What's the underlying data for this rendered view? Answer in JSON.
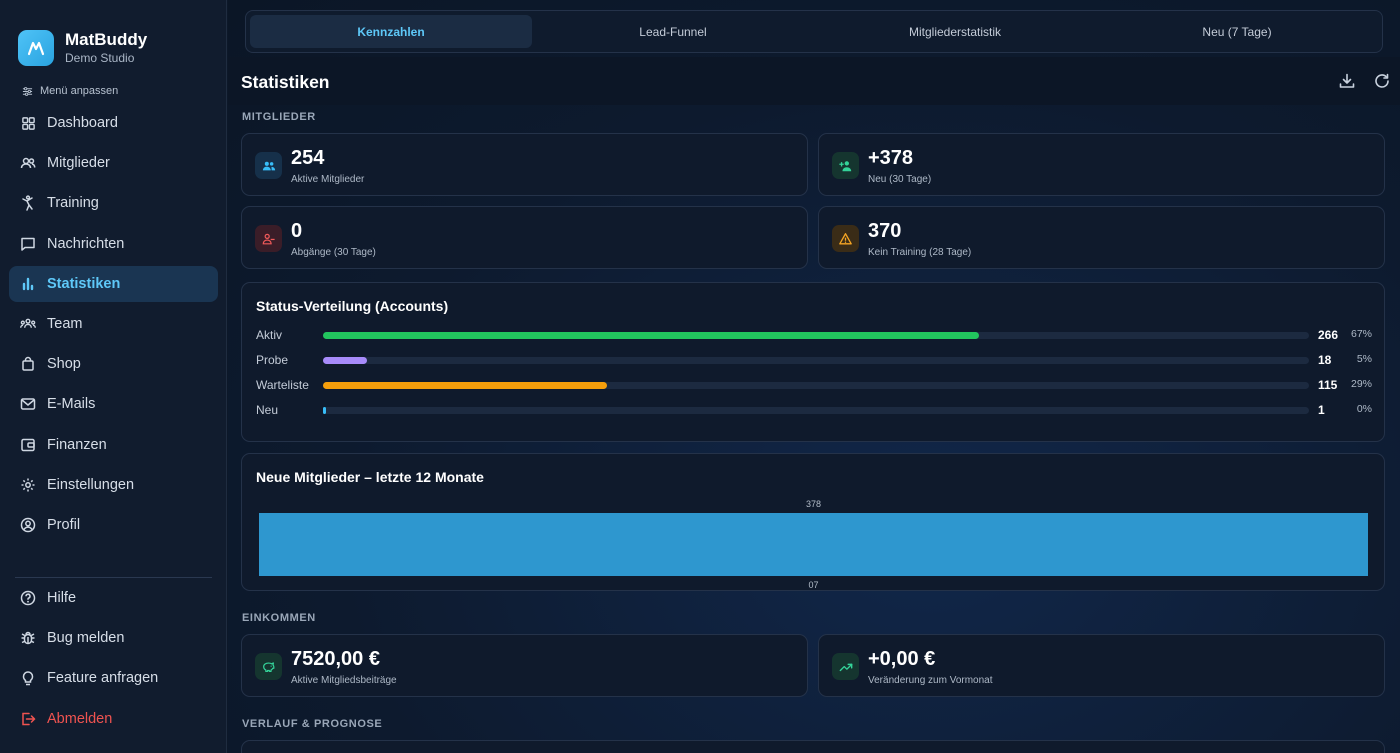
{
  "brand": {
    "name": "MatBuddy",
    "subtitle": "Demo Studio"
  },
  "menu_customize": "Menü anpassen",
  "nav": [
    {
      "label": "Dashboard",
      "icon": "grid-icon",
      "active": false
    },
    {
      "label": "Mitglieder",
      "icon": "users-icon",
      "active": false
    },
    {
      "label": "Training",
      "icon": "martial-arts-icon",
      "active": false
    },
    {
      "label": "Nachrichten",
      "icon": "chat-icon",
      "active": false
    },
    {
      "label": "Statistiken",
      "icon": "bar-chart-icon",
      "active": true
    },
    {
      "label": "Team",
      "icon": "team-icon",
      "active": false
    },
    {
      "label": "Shop",
      "icon": "shopping-bag-icon",
      "active": false
    },
    {
      "label": "E-Mails",
      "icon": "mail-icon",
      "active": false
    },
    {
      "label": "Finanzen",
      "icon": "wallet-icon",
      "active": false
    },
    {
      "label": "Einstellungen",
      "icon": "gear-icon",
      "active": false
    },
    {
      "label": "Profil",
      "icon": "profile-icon",
      "active": false
    }
  ],
  "nav_bottom": [
    {
      "label": "Hilfe",
      "icon": "help-icon"
    },
    {
      "label": "Bug melden",
      "icon": "bug-icon"
    },
    {
      "label": "Feature anfragen",
      "icon": "lightbulb-icon"
    },
    {
      "label": "Abmelden",
      "icon": "logout-icon"
    }
  ],
  "tabs": [
    "Kennzahlen",
    "Lead-Funnel",
    "Mitgliederstatistik",
    "Neu (7 Tage)"
  ],
  "active_tab": 0,
  "page": {
    "title": "Statistiken"
  },
  "sections": {
    "members": "MITGLIEDER",
    "income": "EINKOMMEN",
    "history": "VERLAUF & PROGNOSE"
  },
  "member_stats": [
    {
      "value": "254",
      "label": "Aktive Mitglieder",
      "icon": "users-icon",
      "color": "#38bdf8"
    },
    {
      "value": "+378",
      "label": "Neu (30 Tage)",
      "icon": "user-plus-icon",
      "color": "#34d399"
    },
    {
      "value": "0",
      "label": "Abgänge (30 Tage)",
      "icon": "user-minus-icon",
      "color": "#f05a5a"
    },
    {
      "value": "370",
      "label": "Kein Training (28 Tage)",
      "icon": "warning-icon",
      "color": "#f5a524"
    }
  ],
  "status_distribution": {
    "title": "Status-Verteilung (Accounts)",
    "rows": [
      {
        "label": "Aktiv",
        "count": "266",
        "percent": "67%",
        "fraction": 0.665,
        "color": "#22c55e"
      },
      {
        "label": "Probe",
        "count": "18",
        "percent": "5%",
        "fraction": 0.045,
        "color": "#a78bfa"
      },
      {
        "label": "Warteliste",
        "count": "115",
        "percent": "29%",
        "fraction": 0.288,
        "color": "#f59e0b"
      },
      {
        "label": "Neu",
        "count": "1",
        "percent": "0%",
        "fraction": 0.003,
        "color": "#38bdf8"
      }
    ]
  },
  "new_members_chart": {
    "title": "Neue Mitglieder – letzte 12 Monate"
  },
  "chart_data": {
    "type": "bar",
    "title": "Neue Mitglieder – letzte 12 Monate",
    "categories": [
      "07"
    ],
    "values": [
      378
    ],
    "data_labels": [
      "378"
    ],
    "xlabel": "",
    "ylabel": "",
    "color": "#2e97cf"
  },
  "income_stats": [
    {
      "value": "7520,00 €",
      "label": "Aktive Mitgliedsbeiträge",
      "icon": "piggy-bank-icon",
      "color": "#34d399"
    },
    {
      "value": "+0,00 €",
      "label": "Veränderung zum Vormonat",
      "icon": "trend-up-icon",
      "color": "#34d399"
    }
  ]
}
